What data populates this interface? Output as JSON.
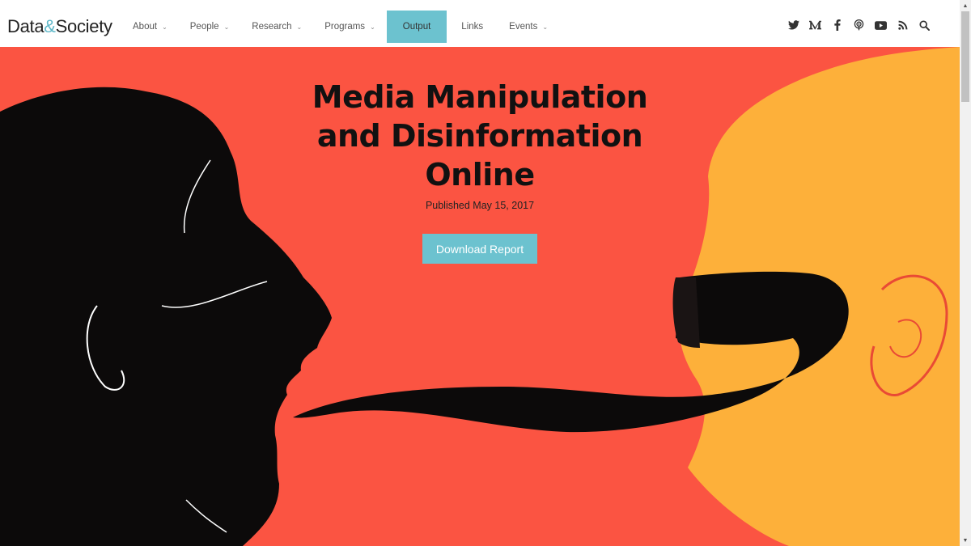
{
  "logo": {
    "part1": "Data",
    "amp": "&",
    "part2": "Society"
  },
  "nav": [
    {
      "label": "About",
      "dropdown": true,
      "active": false
    },
    {
      "label": "People",
      "dropdown": true,
      "active": false
    },
    {
      "label": "Research",
      "dropdown": true,
      "active": false
    },
    {
      "label": "Programs",
      "dropdown": true,
      "active": false
    },
    {
      "label": "Output",
      "dropdown": false,
      "active": true
    },
    {
      "label": "Links",
      "dropdown": false,
      "active": false
    },
    {
      "label": "Events",
      "dropdown": true,
      "active": false
    }
  ],
  "social_icons": [
    "twitter-icon",
    "medium-icon",
    "facebook-icon",
    "podcast-icon",
    "youtube-icon",
    "rss-icon",
    "search-icon"
  ],
  "hero": {
    "title_line1": "Media Manipulation",
    "title_line2": "and Disinformation",
    "title_line3": "Online",
    "published": "Published May 15, 2017",
    "button_label": "Download Report"
  },
  "colors": {
    "accent": "#6cc2cf",
    "hero_bg": "#fb5442",
    "face_yellow": "#fdb03a"
  }
}
